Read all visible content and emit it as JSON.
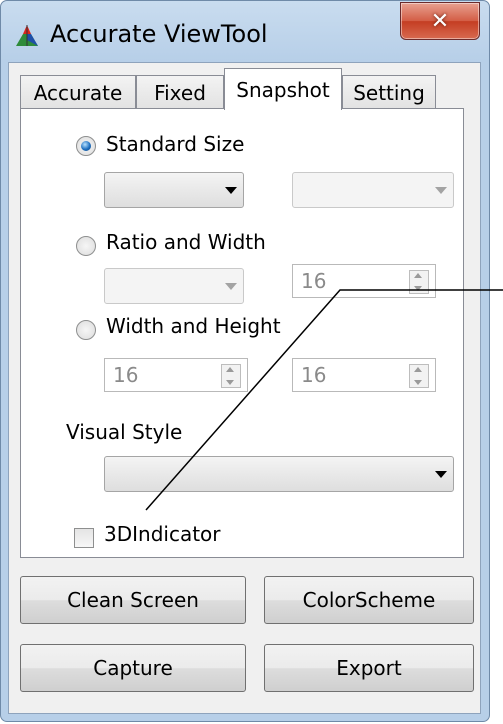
{
  "window": {
    "title": "Accurate ViewTool",
    "close_glyph": "✕",
    "icon": "app-icon"
  },
  "tabs": [
    {
      "label": "Accurate",
      "active": false
    },
    {
      "label": "Fixed",
      "active": false
    },
    {
      "label": "Snapshot",
      "active": true
    },
    {
      "label": "Setting",
      "active": false
    }
  ],
  "snapshot": {
    "standard_size": {
      "label": "Standard Size",
      "checked": true
    },
    "ratio_width": {
      "label": "Ratio and Width",
      "checked": false,
      "width_value": "16"
    },
    "width_height": {
      "label": "Width and Height",
      "checked": false,
      "width_value": "16",
      "height_value": "16"
    },
    "visual_style": {
      "label": "Visual Style"
    },
    "indicator": {
      "label": "3DIndicator",
      "checked": false
    }
  },
  "buttons": {
    "clean_screen": "Clean Screen",
    "color_scheme": "ColorScheme",
    "capture": "Capture",
    "export": "Export"
  },
  "colors": {
    "title_bar": "#b7cfe8",
    "close_button": "#c43d22",
    "radio_selected": "#1e6fc0"
  }
}
